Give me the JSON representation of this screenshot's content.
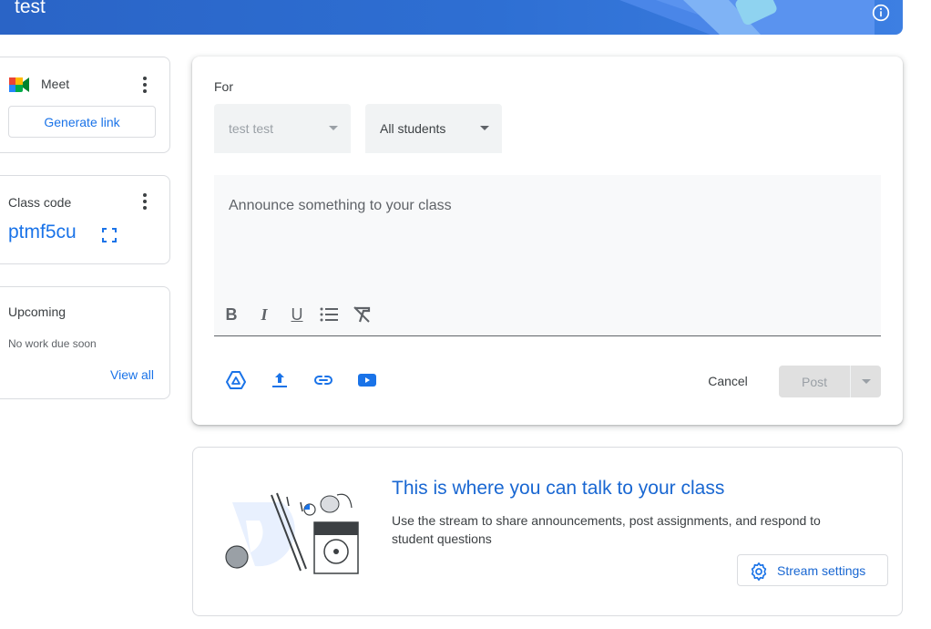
{
  "banner": {
    "title": "test"
  },
  "meet": {
    "title": "Meet",
    "generate_link": "Generate link"
  },
  "class_code": {
    "label": "Class code",
    "value": "ptmf5cu"
  },
  "upcoming": {
    "title": "Upcoming",
    "empty": "No work due soon",
    "view_all": "View all"
  },
  "composer": {
    "for_label": "For",
    "class_select": "test test",
    "audience_select": "All students",
    "placeholder": "Announce something to your class",
    "formatting": {
      "bold": "B",
      "italic": "I",
      "underline": "U"
    },
    "cancel": "Cancel",
    "post": "Post"
  },
  "stream_info": {
    "title": "This is where you can talk to your class",
    "description": "Use the stream to share announcements, post assignments, and respond to student questions",
    "settings_button": "Stream settings"
  },
  "colors": {
    "accent": "#1a73e8",
    "banner": "#2a64c6",
    "youtube_icon": "#1a73e8"
  },
  "icons": [
    "info-icon",
    "meet-icon",
    "more-vert-icon",
    "expand-icon",
    "bold-icon",
    "italic-icon",
    "underline-icon",
    "bulleted-list-icon",
    "clear-format-icon",
    "drive-icon",
    "upload-icon",
    "link-icon",
    "youtube-icon",
    "gear-icon"
  ]
}
